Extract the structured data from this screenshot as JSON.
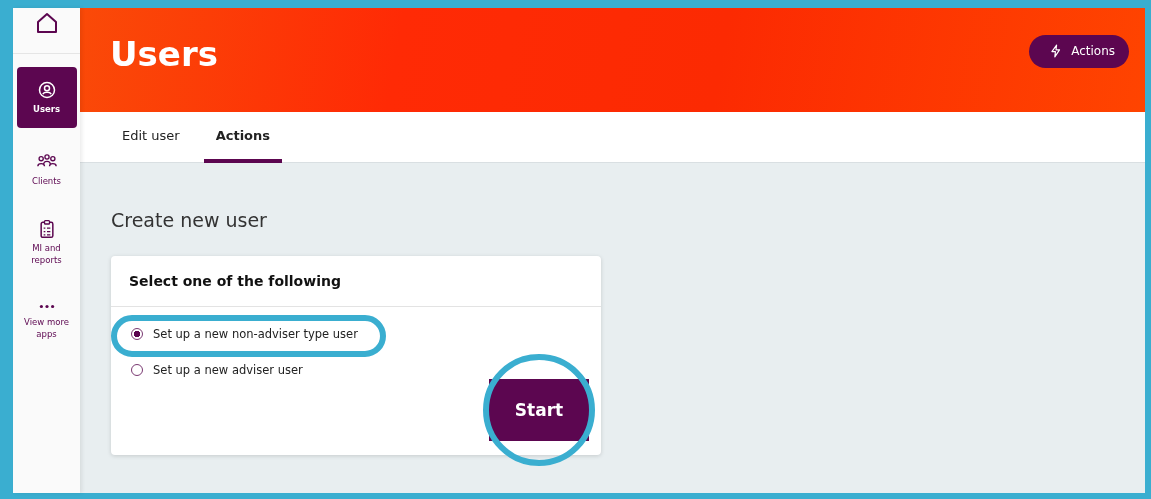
{
  "sidebar": {
    "items": [
      {
        "label": "Users",
        "selected": true
      },
      {
        "label": "Clients",
        "selected": false
      },
      {
        "label": "MI and reports",
        "selected": false
      },
      {
        "label": "View more apps",
        "selected": false
      }
    ]
  },
  "header": {
    "title": "Users",
    "action_button": "Actions"
  },
  "tabs": [
    {
      "label": "Edit user",
      "selected": false
    },
    {
      "label": "Actions",
      "selected": true
    }
  ],
  "section_title": "Create new user",
  "card": {
    "title": "Select one of the following",
    "options": [
      {
        "label": "Set up a new non-adviser type user",
        "selected": true,
        "highlighted": true
      },
      {
        "label": "Set up a new adviser user",
        "selected": false,
        "highlighted": false
      }
    ],
    "button": {
      "label": "Start",
      "highlighted": true
    }
  }
}
